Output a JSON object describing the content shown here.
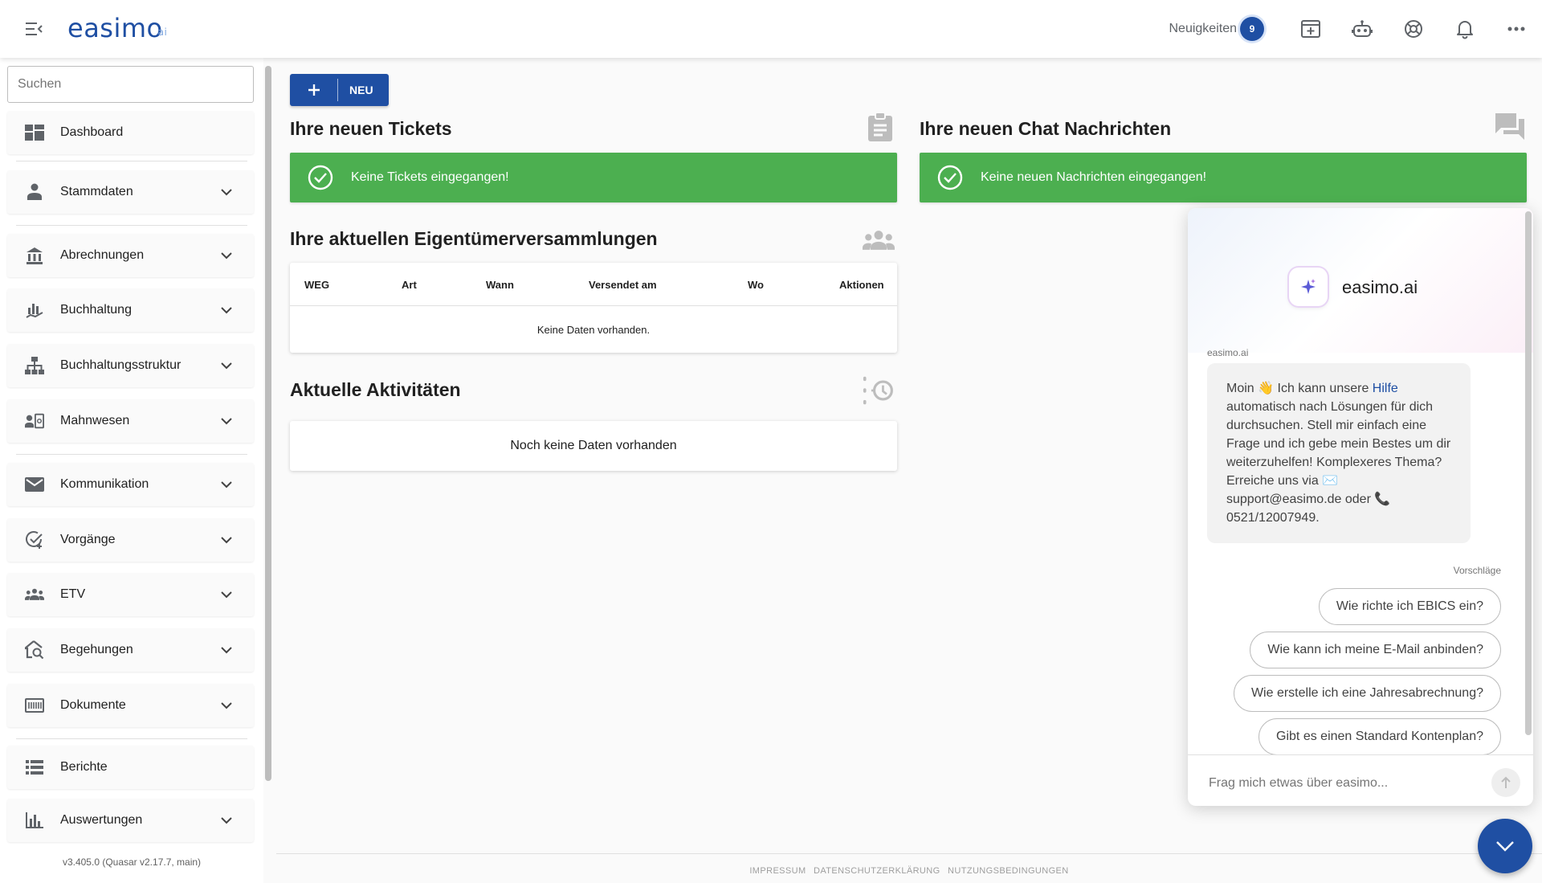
{
  "header": {
    "logo_text": "easimo",
    "logo_sub": "ai",
    "news_label": "Neuigkeiten",
    "news_count": "9",
    "icons": [
      "add-window-icon",
      "robot-icon",
      "support-icon",
      "bell-icon",
      "more-icon"
    ]
  },
  "sidebar": {
    "search_placeholder": "Suchen",
    "items": [
      {
        "label": "Dashboard",
        "icon": "dashboard-icon",
        "expandable": false
      },
      {
        "label": "Stammdaten",
        "icon": "person-icon",
        "expandable": true
      },
      {
        "label": "Abrechnungen",
        "icon": "bank-icon",
        "expandable": true
      },
      {
        "label": "Buchhaltung",
        "icon": "chart-hand-icon",
        "expandable": true
      },
      {
        "label": "Buchhaltungsstruktur",
        "icon": "hierarchy-icon",
        "expandable": true
      },
      {
        "label": "Mahnwesen",
        "icon": "contact-mail-icon",
        "expandable": true
      },
      {
        "label": "Kommunikation",
        "icon": "mail-icon",
        "expandable": true
      },
      {
        "label": "Vorgänge",
        "icon": "task-check-icon",
        "expandable": true
      },
      {
        "label": "ETV",
        "icon": "group-icon",
        "expandable": true
      },
      {
        "label": "Begehungen",
        "icon": "home-search-icon",
        "expandable": true
      },
      {
        "label": "Dokumente",
        "icon": "document-icon",
        "expandable": true
      },
      {
        "label": "Berichte",
        "icon": "list-icon",
        "expandable": false
      },
      {
        "label": "Auswertungen",
        "icon": "bar-chart-icon",
        "expandable": true
      }
    ],
    "version": "v3.405.0 (Quasar v2.17.7, main)"
  },
  "main": {
    "new_button": "NEU",
    "tickets": {
      "title": "Ihre neuen Tickets",
      "empty": "Keine Tickets eingegangen!"
    },
    "chat_messages": {
      "title": "Ihre neuen Chat Nachrichten",
      "empty": "Keine neuen Nachrichten eingegangen!"
    },
    "assemblies": {
      "title": "Ihre aktuellen Eigentümerversammlungen",
      "columns": [
        "WEG",
        "Art",
        "Wann",
        "Versendet am",
        "Wo",
        "Aktionen"
      ],
      "empty": "Keine Daten vorhanden."
    },
    "activities": {
      "title": "Aktuelle Aktivitäten",
      "empty": "Noch keine Daten vorhanden"
    }
  },
  "footer": {
    "links": [
      "IMPRESSUM",
      "DATENSCHUTZERKLÄRUNG",
      "NUTZUNGSBEDINGUNGEN"
    ]
  },
  "chat": {
    "name": "easimo.ai",
    "sender": "easimo.ai",
    "message_part1": "Moin 👋 Ich kann unsere ",
    "message_link": "Hilfe",
    "message_part2": " automatisch nach Lösungen für dich durchsuchen. Stell mir einfach eine Frage und ich gebe mein Bestes um dir weiterzuhelfen! Komplexeres Thema? Erreiche uns via ✉️ support@easimo.de oder 📞 0521/12007949.",
    "suggestions_label": "Vorschläge",
    "suggestions": [
      "Wie richte ich EBICS ein?",
      "Wie kann ich meine E-Mail anbinden?",
      "Wie erstelle ich eine Jahresabrechnung?",
      "Gibt es einen Standard Kontenplan?"
    ],
    "input_placeholder": "Frag mich etwas über easimo..."
  },
  "colors": {
    "primary": "#1f4fa3",
    "success": "#4caf50"
  }
}
